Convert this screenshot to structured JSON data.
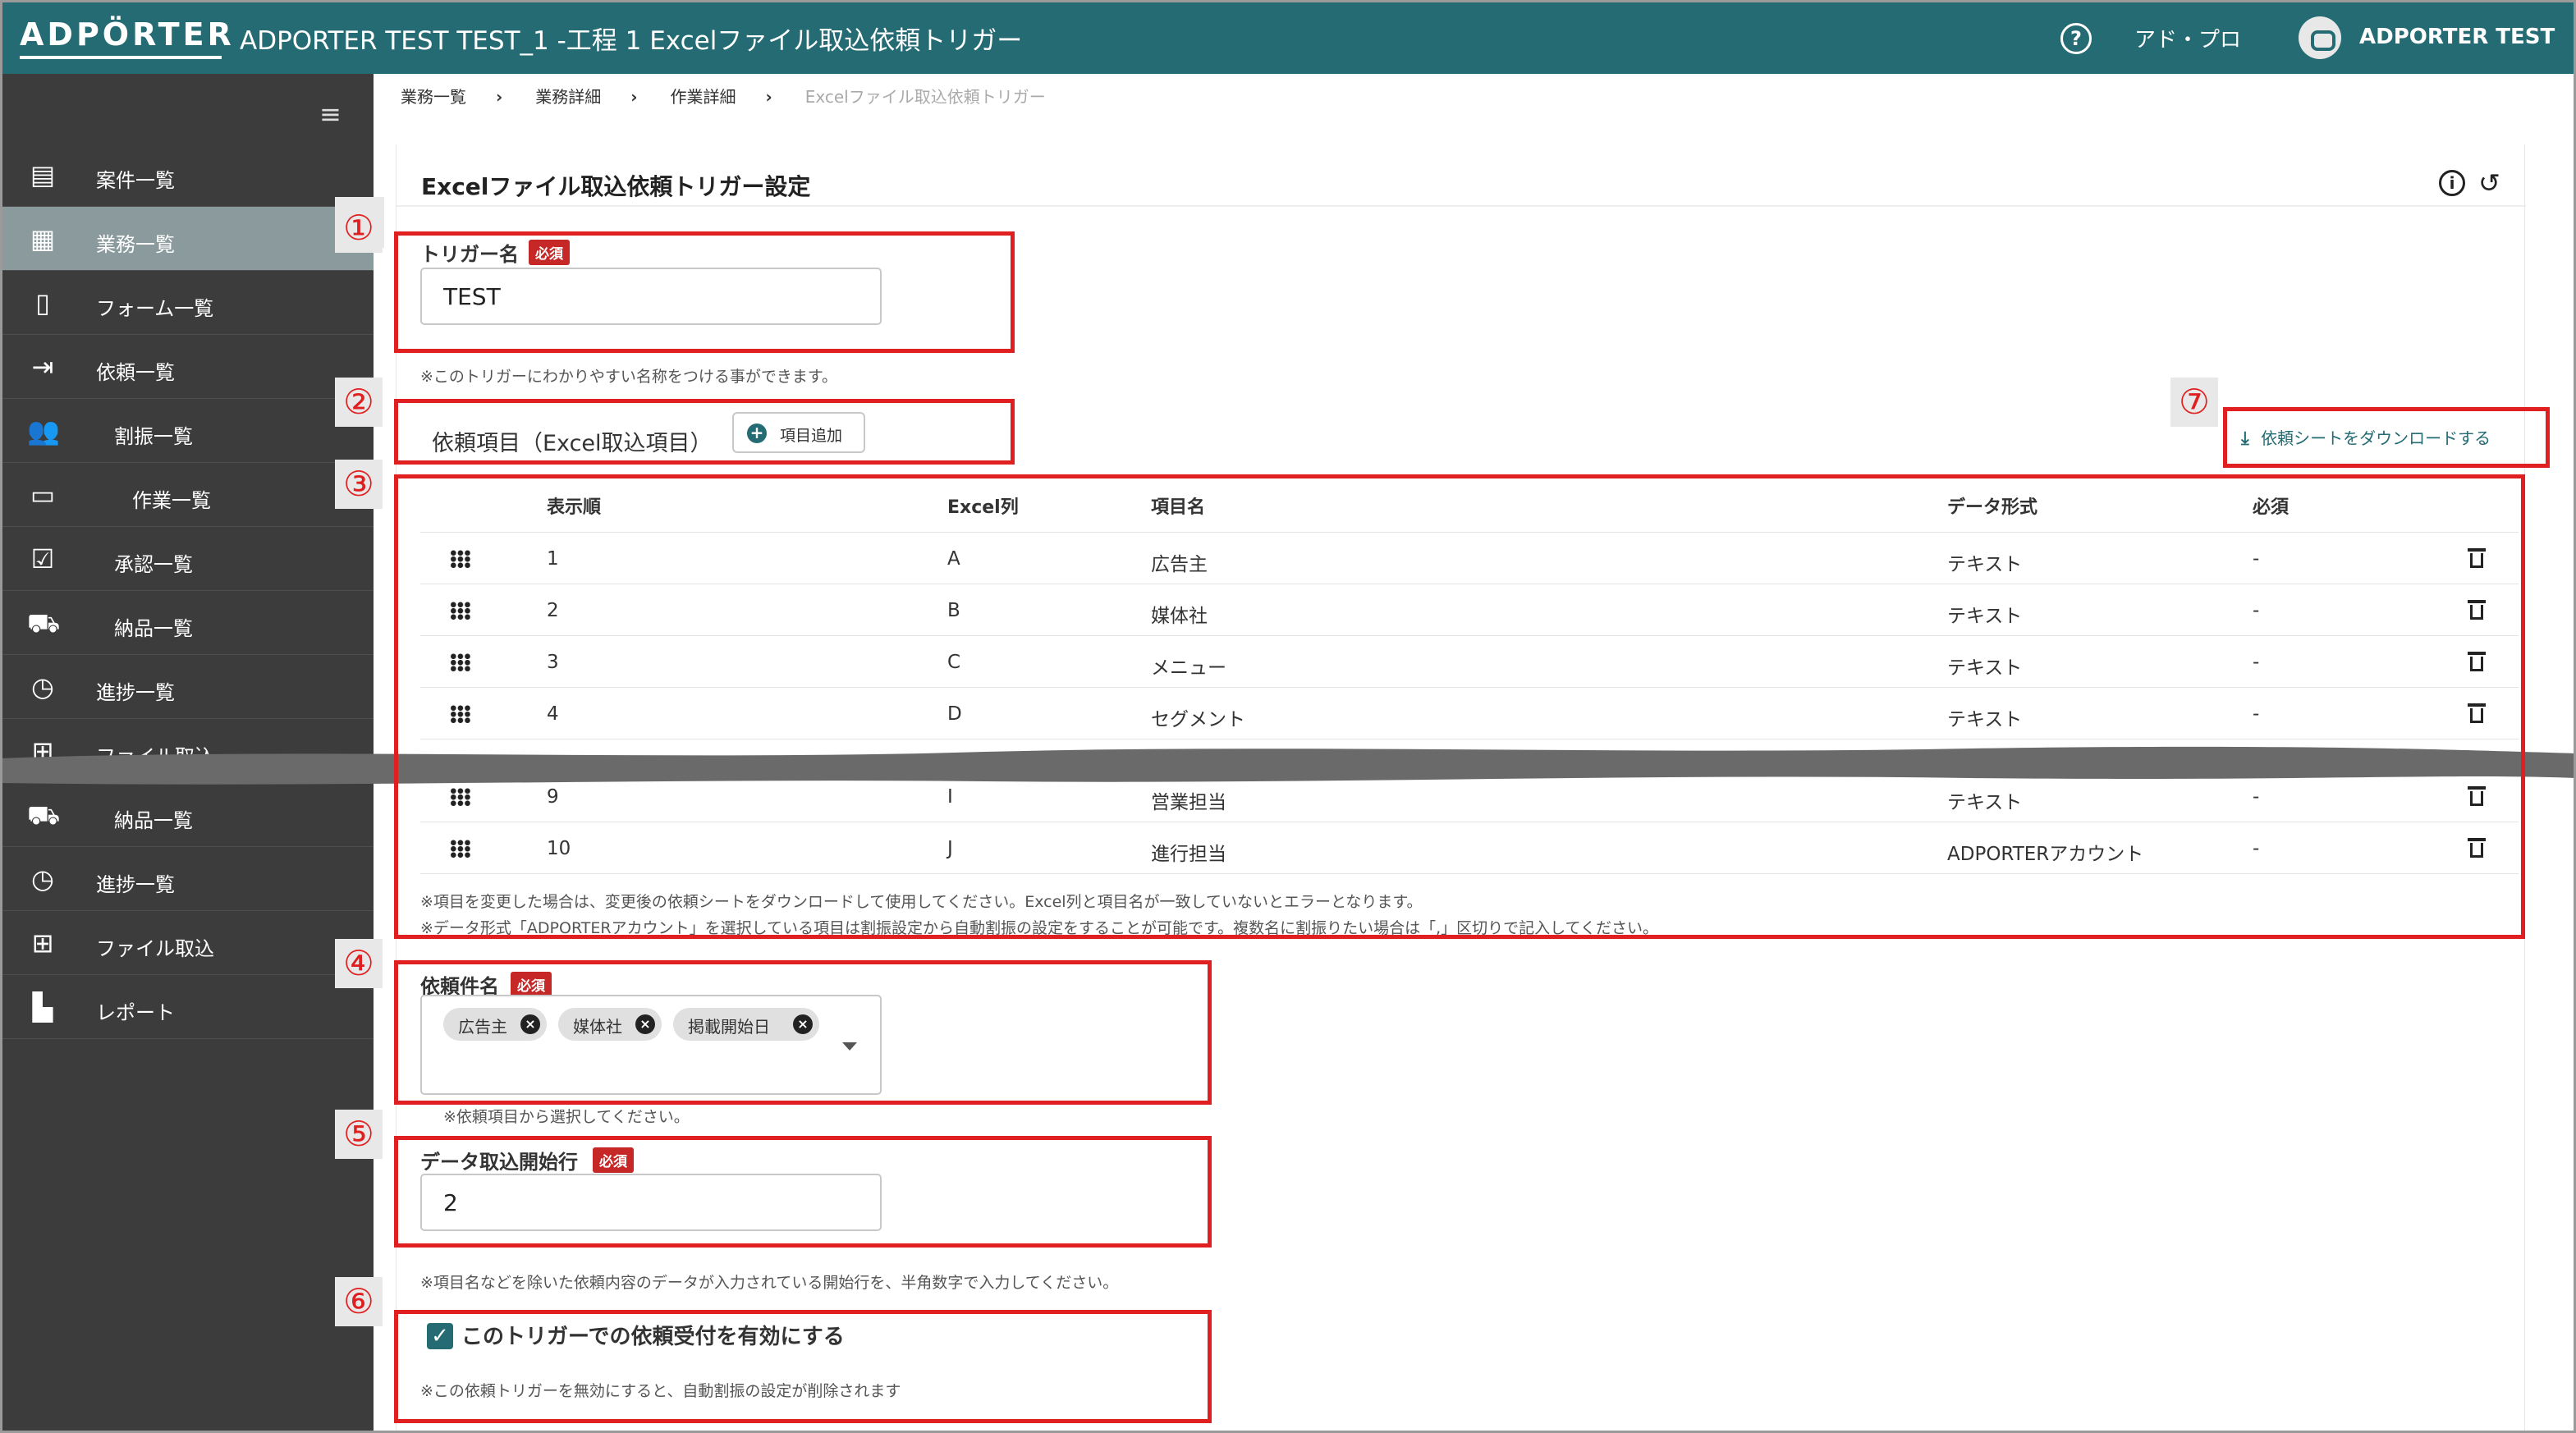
{
  "header": {
    "logo": "ADPÖRTER",
    "title": "ADPORTER TEST TEST_1 -工程 1 Excelファイル取込依頼トリガー",
    "menu": "アド・プロ",
    "user": "ADPORTER TEST"
  },
  "sidebar": {
    "items": [
      {
        "label": "案件一覧",
        "icon": "document-icon"
      },
      {
        "label": "業務一覧",
        "icon": "building-icon",
        "active": true
      },
      {
        "label": "フォーム一覧",
        "icon": "form-icon"
      },
      {
        "label": "依頼一覧",
        "icon": "login-icon"
      },
      {
        "label": "割振一覧",
        "icon": "people-icon"
      },
      {
        "label": "作業一覧",
        "icon": "monitor-icon"
      },
      {
        "label": "承認一覧",
        "icon": "approval-icon"
      },
      {
        "label": "納品一覧",
        "icon": "truck-icon"
      },
      {
        "label": "進捗一覧",
        "icon": "clock-icon"
      },
      {
        "label": "ファイル取込",
        "icon": "table-add-icon"
      },
      {
        "label": "納品一覧",
        "icon": "truck-icon"
      },
      {
        "label": "進捗一覧",
        "icon": "clock-icon"
      },
      {
        "label": "ファイル取込",
        "icon": "table-add-icon"
      },
      {
        "label": "レポート",
        "icon": "bar-chart-icon"
      }
    ]
  },
  "breadcrumb": [
    "業務一覧",
    "業務詳細",
    "作業詳細",
    "Excelファイル取込依頼トリガー"
  ],
  "page": {
    "title": "Excelファイル取込依頼トリガー設定"
  },
  "trigger_name": {
    "label": "トリガー名",
    "required": "必須",
    "value": "TEST",
    "hint": "※このトリガーにわかりやすい名称をつける事ができます。"
  },
  "request_items": {
    "label": "依頼項目（Excel取込項目）",
    "add_button": "項目追加",
    "download": "依頼シートをダウンロードする",
    "columns": [
      "表示順",
      "Excel列",
      "項目名",
      "データ形式",
      "必須"
    ],
    "rows": [
      {
        "order": "1",
        "col": "A",
        "name": "広告主",
        "format": "テキスト",
        "required": "-"
      },
      {
        "order": "2",
        "col": "B",
        "name": "媒体社",
        "format": "テキスト",
        "required": "-"
      },
      {
        "order": "3",
        "col": "C",
        "name": "メニュー",
        "format": "テキスト",
        "required": "-"
      },
      {
        "order": "4",
        "col": "D",
        "name": "セグメント",
        "format": "テキスト",
        "required": "-"
      },
      {
        "order": "9",
        "col": "I",
        "name": "営業担当",
        "format": "テキスト",
        "required": "-"
      },
      {
        "order": "10",
        "col": "J",
        "name": "進行担当",
        "format": "ADPORTERアカウント",
        "required": "-"
      }
    ],
    "note1": "※項目を変更した場合は、変更後の依頼シートをダウンロードして使用してください。Excel列と項目名が一致していないとエラーとなります。",
    "note2": "※データ形式「ADPORTERアカウント」を選択している項目は割振設定から自動割振の設定をすることが可能です。複数名に割振りたい場合は「,」区切りで記入してください。"
  },
  "subject": {
    "label": "依頼件名",
    "required": "必須",
    "chips": [
      "広告主",
      "媒体社",
      "掲載開始日"
    ],
    "hint": "※依頼項目から選択してください。"
  },
  "start_row": {
    "label": "データ取込開始行",
    "required": "必須",
    "value": "2",
    "hint": "※項目名などを除いた依頼内容のデータが入力されている開始行を、半角数字で入力してください。"
  },
  "enable": {
    "label": "このトリガーでの依頼受付を有効にする",
    "checked": true,
    "hint": "※この依頼トリガーを無効にすると、自動割振の設定が削除されます"
  },
  "annotations": [
    "①",
    "②",
    "③",
    "④",
    "⑤",
    "⑥",
    "⑦"
  ],
  "colors": {
    "header": "#246b73",
    "sidebar": "#3c3c3c",
    "active": "#8a9a9d",
    "annotation": "#e02020",
    "required": "#c62828"
  }
}
